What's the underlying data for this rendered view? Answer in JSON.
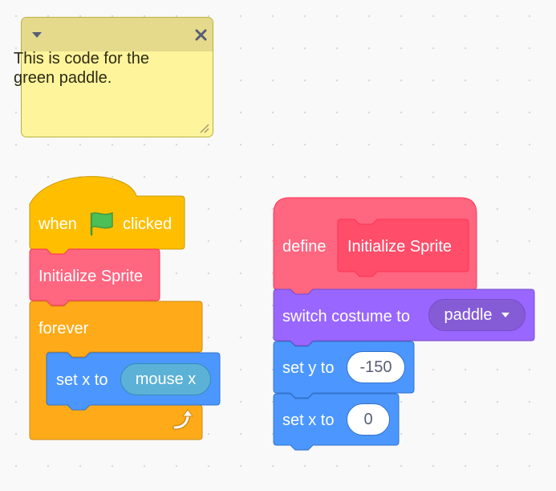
{
  "comment": {
    "text": "This is code for the green paddle."
  },
  "script_paddle": {
    "hat": {
      "before": "when",
      "after": "clicked",
      "flag_icon": "green-flag-icon"
    },
    "call_block": "Initialize Sprite",
    "forever_label": "forever",
    "set_x": {
      "label": "set x to",
      "reporter": "mouse x"
    }
  },
  "script_define": {
    "define_label": "define",
    "proc_name": "Initialize Sprite",
    "switch_costume": {
      "label": "switch costume to",
      "value": "paddle"
    },
    "set_y": {
      "label": "set y to",
      "value": "-150"
    },
    "set_x": {
      "label": "set x to",
      "value": "0"
    }
  },
  "colors": {
    "events": "#ffbf00",
    "control": "#ffab19",
    "my_blocks": "#ff6680",
    "motion": "#4c97ff",
    "looks": "#9966ff",
    "sensing": "#5cb1d6",
    "comment_bg": "#fef49c"
  }
}
